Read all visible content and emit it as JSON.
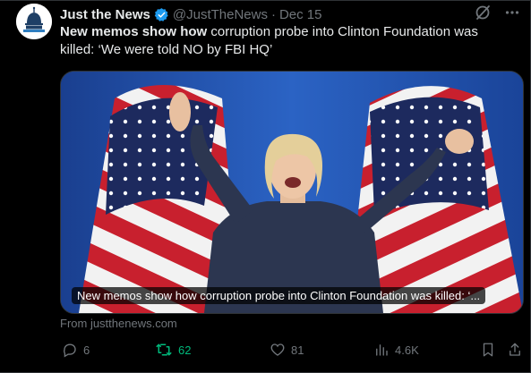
{
  "post": {
    "author_name": "Just the News",
    "handle": "@JustTheNews",
    "separator": "·",
    "date": "Dec 15",
    "text_bold": "New memos show how",
    "text_rest": " corruption probe into Clinton Foundation was killed: ‘We were told NO by FBI HQ’"
  },
  "card": {
    "caption": "New memos show how corruption probe into Clinton Foundation was killed: ‘...",
    "source": "From justthenews.com"
  },
  "actions": {
    "replies": "6",
    "reposts": "62",
    "likes": "81",
    "views": "4.6K"
  },
  "colors": {
    "background": "#000000",
    "text": "#e7e9ea",
    "muted": "#71767b",
    "verified": "#1d9bf0",
    "repost_active": "#00ba7c"
  }
}
